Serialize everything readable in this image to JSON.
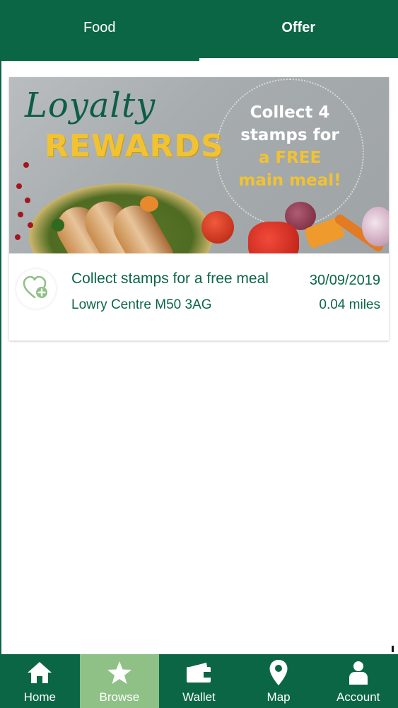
{
  "tabs": [
    {
      "label": "Food",
      "active": false
    },
    {
      "label": "Offer",
      "active": true
    }
  ],
  "offer": {
    "banner": {
      "script_text": "Loyalty",
      "headline": "REWARDS",
      "promo_line1": "Collect 4",
      "promo_line2": "stamps for",
      "promo_line3": "a FREE",
      "promo_line4": "main meal!"
    },
    "title": "Collect stamps for a free meal",
    "date": "30/09/2019",
    "location": "Lowry Centre M50 3AG",
    "distance": "0.04 miles",
    "favorite_icon": "heart-plus-icon"
  },
  "bottom_nav": [
    {
      "label": "Home",
      "icon": "home-icon",
      "active": false
    },
    {
      "label": "Browse",
      "icon": "star-icon",
      "active": true
    },
    {
      "label": "Wallet",
      "icon": "wallet-icon",
      "active": false
    },
    {
      "label": "Map",
      "icon": "map-pin-icon",
      "active": false
    },
    {
      "label": "Account",
      "icon": "account-icon",
      "active": false
    }
  ],
  "colors": {
    "primary": "#0b6646",
    "nav_active": "#8fc187",
    "gold": "#f1c232"
  }
}
